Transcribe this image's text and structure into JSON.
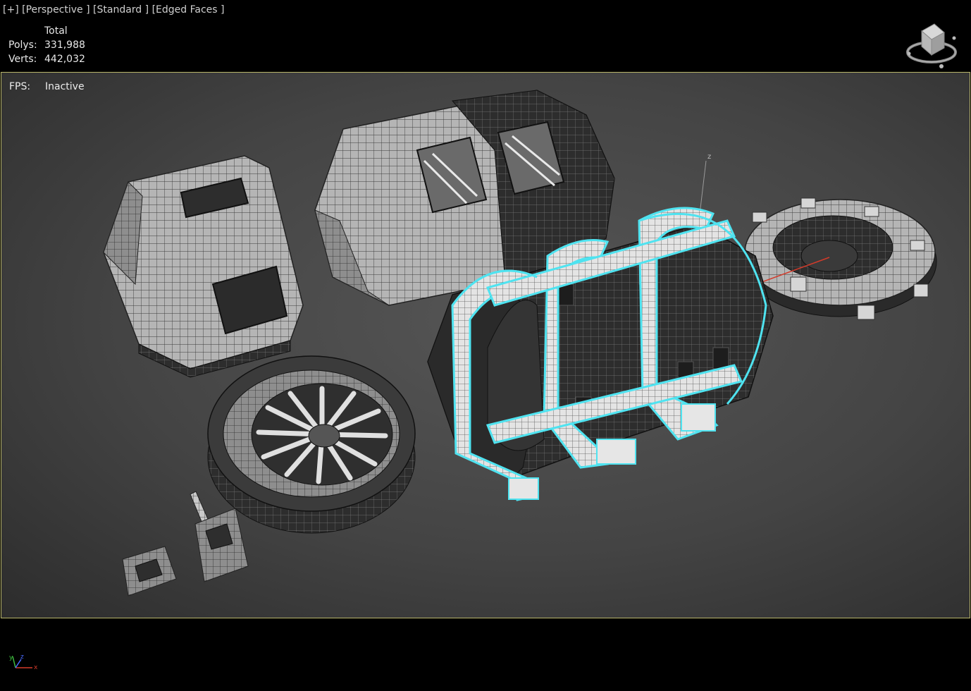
{
  "viewport_label": {
    "plus": "[+]",
    "perspective": "[Perspective ]",
    "shading": "[Standard ]",
    "edged": "[Edged Faces ]"
  },
  "stats": {
    "header": "Total",
    "polys_label": "Polys:",
    "polys_value": "331,988",
    "verts_label": "Verts:",
    "verts_value": "442,032",
    "fps_label": "FPS:",
    "fps_value": "Inactive"
  },
  "gizmo": {
    "z": "z",
    "axis_x": "x",
    "axis_y": "y",
    "axis_z": "z"
  },
  "colors": {
    "viewport_border": "#b9b66a",
    "selection": "#4fe3f0",
    "gizmo_red": "#d23a2a",
    "mesh_light": "#bdbdbd",
    "mesh_dark": "#2a2a2a"
  }
}
